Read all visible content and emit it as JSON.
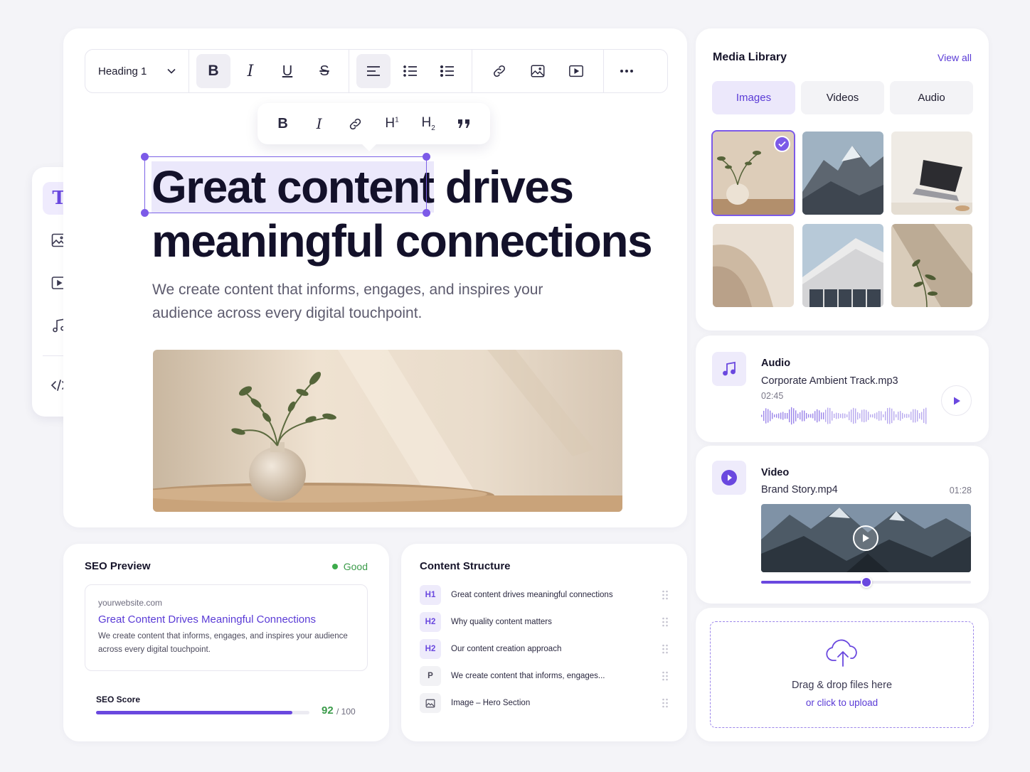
{
  "toolbar": {
    "heading_select": "Heading 1"
  },
  "bubble": {
    "h1_label": "H",
    "h1_sup": "1",
    "h2_label": "H",
    "h2_sub": "2"
  },
  "editor": {
    "headline_selected": "Great content",
    "headline_rest_1": " drives",
    "headline_line2": "meaningful connections",
    "subtext": "We create content that informs, engages, and inspires your audience across every digital touchpoint."
  },
  "seo": {
    "title": "SEO Preview",
    "status": "Good",
    "url": "yourwebsite.com",
    "snippet_title": "Great Content Drives Meaningful Connections",
    "snippet_desc": "We create content that informs, engages, and inspires your audience across every digital touchpoint.",
    "score_label": "SEO Score",
    "score": "92",
    "score_max": "/ 100",
    "score_fraction": 0.92
  },
  "structure": {
    "title": "Content Structure",
    "items": [
      {
        "tag": "H1",
        "text": "Great content drives meaningful connections"
      },
      {
        "tag": "H2",
        "text": "Why quality content matters"
      },
      {
        "tag": "H2",
        "text": "Our content creation approach"
      },
      {
        "tag": "P",
        "text": "We create content that informs, engages..."
      },
      {
        "tag": "image-icon",
        "text": "Image – Hero Section"
      }
    ]
  },
  "media": {
    "title": "Media Library",
    "view_all": "View all",
    "tabs": [
      "Images",
      "Videos",
      "Audio"
    ],
    "active_tab": "Images"
  },
  "audio": {
    "label": "Audio",
    "file": "Corporate Ambient Track.mp3",
    "duration": "02:45"
  },
  "video": {
    "label": "Video",
    "file": "Brand Story.mp4",
    "duration": "01:28",
    "progress": 0.5
  },
  "upload": {
    "main": "Drag & drop files here",
    "sub": "or click to upload"
  },
  "colors": {
    "accent": "#6a48df",
    "good": "#3dab4b"
  }
}
